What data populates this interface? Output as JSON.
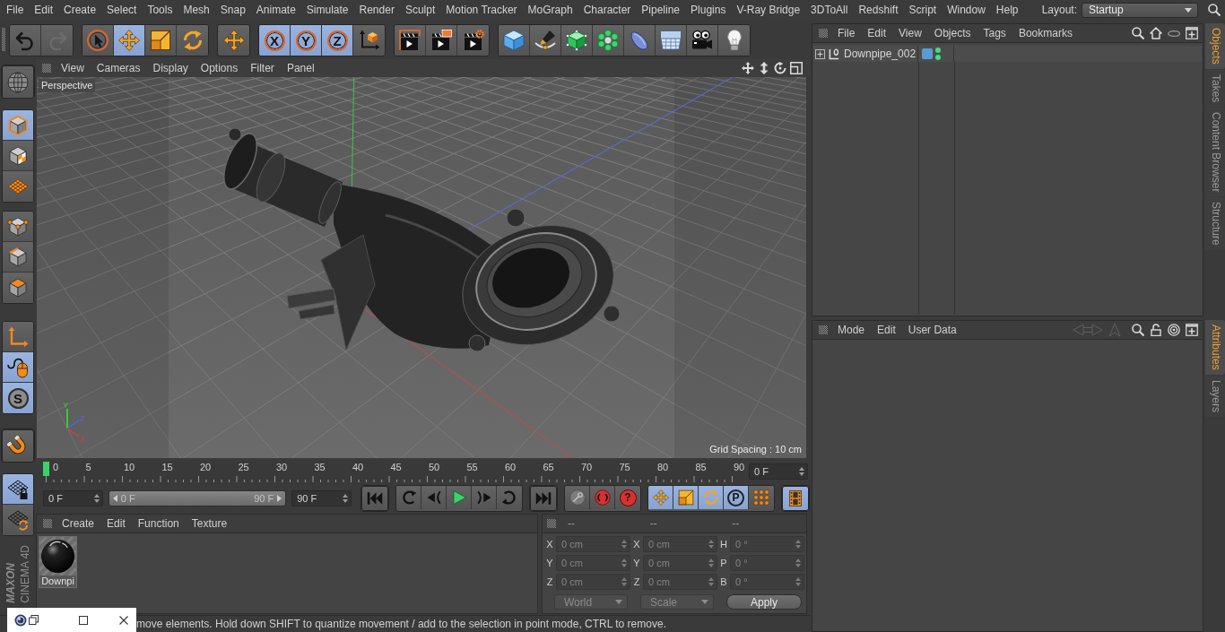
{
  "menu_bar": {
    "items": [
      "File",
      "Edit",
      "Create",
      "Select",
      "Tools",
      "Mesh",
      "Snap",
      "Animate",
      "Simulate",
      "Render",
      "Sculpt",
      "Motion Tracker",
      "MoGraph",
      "Character",
      "Pipeline",
      "Plugins",
      "V-Ray Bridge",
      "3DToAll",
      "Redshift",
      "Script",
      "Window",
      "Help"
    ],
    "layout_label": "Layout:",
    "layout_value": "Startup"
  },
  "toolbar": {
    "groups": [
      {
        "tools": [
          {
            "kind": "undo",
            "selected": false,
            "disabled": false
          },
          {
            "kind": "redo",
            "selected": false,
            "disabled": true
          }
        ]
      },
      {
        "tools": [
          {
            "kind": "select",
            "selected": false,
            "disabled": false
          },
          {
            "kind": "move",
            "selected": true,
            "disabled": false
          },
          {
            "kind": "scale",
            "selected": false,
            "disabled": false
          },
          {
            "kind": "rotate",
            "selected": false,
            "disabled": false
          }
        ]
      },
      {
        "tools": [
          {
            "kind": "move",
            "selected": false,
            "disabled": false
          }
        ]
      },
      {
        "tools": [
          {
            "kind": "axis",
            "label": "X",
            "selected": true,
            "disabled": false
          },
          {
            "kind": "axis",
            "label": "Y",
            "selected": true,
            "disabled": false
          },
          {
            "kind": "axis",
            "label": "Z",
            "selected": true,
            "disabled": false
          },
          {
            "kind": "coords",
            "selected": false,
            "disabled": false
          }
        ]
      },
      {
        "tools": [
          {
            "kind": "render_view",
            "selected": false,
            "disabled": false
          },
          {
            "kind": "render_viewer",
            "selected": false,
            "disabled": false
          },
          {
            "kind": "render_settings",
            "selected": false,
            "disabled": false
          }
        ]
      },
      {
        "tools": [
          {
            "kind": "cube",
            "selected": false,
            "disabled": false
          },
          {
            "kind": "pen",
            "selected": false,
            "disabled": false
          },
          {
            "kind": "subdivision",
            "selected": false,
            "disabled": false
          },
          {
            "kind": "cloner",
            "selected": false,
            "disabled": false
          },
          {
            "kind": "deformer",
            "selected": false,
            "disabled": false
          },
          {
            "kind": "floor",
            "selected": false,
            "disabled": false
          },
          {
            "kind": "camera",
            "selected": false,
            "disabled": false
          },
          {
            "kind": "light",
            "selected": false,
            "disabled": false
          }
        ]
      }
    ]
  },
  "objects_panel": {
    "menu": [
      "File",
      "Edit",
      "View",
      "Objects",
      "Tags",
      "Bookmarks"
    ],
    "objects": [
      {
        "name": "Downpipe_002",
        "expanded": false,
        "editor_visible": true,
        "render_visible": true
      }
    ],
    "tabs": [
      {
        "label": "Objects",
        "selected": true
      },
      {
        "label": "Takes",
        "selected": false
      },
      {
        "label": "Content Browser",
        "selected": false
      },
      {
        "label": "Structure",
        "selected": false
      }
    ]
  },
  "left_toolbar": {
    "groups": [
      {
        "tools": [
          {
            "kind": "globe",
            "selected": false
          }
        ]
      },
      {
        "tools": [
          {
            "kind": "model",
            "selected": true
          },
          {
            "kind": "texture",
            "selected": false
          },
          {
            "kind": "workplane",
            "selected": false
          }
        ]
      },
      {
        "tools": [
          {
            "kind": "points",
            "selected": false
          },
          {
            "kind": "edges",
            "selected": false
          },
          {
            "kind": "polygons",
            "selected": false
          }
        ]
      },
      {
        "tools": [
          {
            "kind": "axes",
            "selected": false
          },
          {
            "kind": "tweak",
            "selected": true
          },
          {
            "kind": "solo",
            "label": "S",
            "selected": true
          }
        ]
      },
      {
        "tools": [
          {
            "kind": "snap",
            "selected": false
          }
        ]
      },
      {
        "tools": [
          {
            "kind": "wp_lock",
            "selected": true
          },
          {
            "kind": "wp_rotate",
            "selected": false
          }
        ]
      }
    ]
  },
  "viewport": {
    "menu": [
      "View",
      "Cameras",
      "Display",
      "Options",
      "Filter",
      "Panel"
    ],
    "camera": "Perspective",
    "grid_spacing": "Grid Spacing : 10 cm",
    "gizmo": [
      {
        "label": "Y",
        "color": "#41c441"
      },
      {
        "label": "Z",
        "color": "#5262e6"
      },
      {
        "label": "X",
        "color": "#d23c3c"
      }
    ]
  },
  "timeline": {
    "ticks": [
      "0",
      "5",
      "10",
      "15",
      "20",
      "25",
      "30",
      "35",
      "40",
      "45",
      "50",
      "55",
      "60",
      "65",
      "70",
      "75",
      "80",
      "85",
      "90"
    ],
    "level": 0,
    "frame": "0 F"
  },
  "playback": {
    "start": "0 F",
    "range": {
      "start": "0 F",
      "end": "90 F",
      "level": 1
    },
    "end": "90 F",
    "groups": [
      {
        "buttons": [
          {
            "kind": "first",
            "selected": false
          }
        ]
      },
      {
        "buttons": [
          {
            "kind": "prev_key",
            "selected": false
          },
          {
            "kind": "prev_frame",
            "selected": false
          },
          {
            "kind": "play",
            "selected": false
          },
          {
            "kind": "next_frame",
            "selected": false
          },
          {
            "kind": "next_key",
            "selected": false
          }
        ]
      },
      {
        "buttons": [
          {
            "kind": "last",
            "selected": false
          }
        ]
      },
      {
        "buttons": [
          {
            "kind": "record",
            "selected": false
          },
          {
            "kind": "autokey",
            "selected": false
          },
          {
            "kind": "key_help",
            "label": "?",
            "selected": false
          }
        ]
      },
      {
        "buttons": [
          {
            "kind": "key_move",
            "selected": true
          },
          {
            "kind": "key_scale",
            "selected": true
          },
          {
            "kind": "key_rotate",
            "selected": true
          },
          {
            "kind": "key_param",
            "label": "P",
            "selected": true
          },
          {
            "kind": "key_points",
            "selected": false
          }
        ]
      },
      {
        "buttons": [
          {
            "kind": "film",
            "selected": true
          }
        ]
      }
    ]
  },
  "materials": {
    "menu": [
      "Create",
      "Edit",
      "Function",
      "Texture"
    ],
    "items": [
      {
        "name": "Downpi"
      }
    ]
  },
  "coordinates": {
    "headers": [
      "--",
      "--",
      "--"
    ],
    "rows": [
      {
        "fields": [
          {
            "label": "X",
            "value": "0 cm"
          },
          {
            "label": "X",
            "value": "0 cm"
          },
          {
            "label": "H",
            "value": "0 °"
          }
        ]
      },
      {
        "fields": [
          {
            "label": "Y",
            "value": "0 cm"
          },
          {
            "label": "Y",
            "value": "0 cm"
          },
          {
            "label": "P",
            "value": "0 °"
          }
        ]
      },
      {
        "fields": [
          {
            "label": "Z",
            "value": "0 cm"
          },
          {
            "label": "Z",
            "value": "0 cm"
          },
          {
            "label": "B",
            "value": "0 °"
          }
        ]
      }
    ],
    "space": "World",
    "mode": "Scale",
    "apply": "Apply"
  },
  "attributes_panel": {
    "menu": [
      "Mode",
      "Edit",
      "User Data"
    ],
    "tabs": [
      {
        "label": "Attributes",
        "selected": true
      },
      {
        "label": "Layers",
        "selected": false
      }
    ]
  },
  "logo": {
    "brand": "MAXON",
    "product": "CINEMA 4D"
  },
  "status_bar": {
    "text": "move elements. Hold down SHIFT to quantize movement / add to the selection in point mode, CTRL to remove."
  }
}
